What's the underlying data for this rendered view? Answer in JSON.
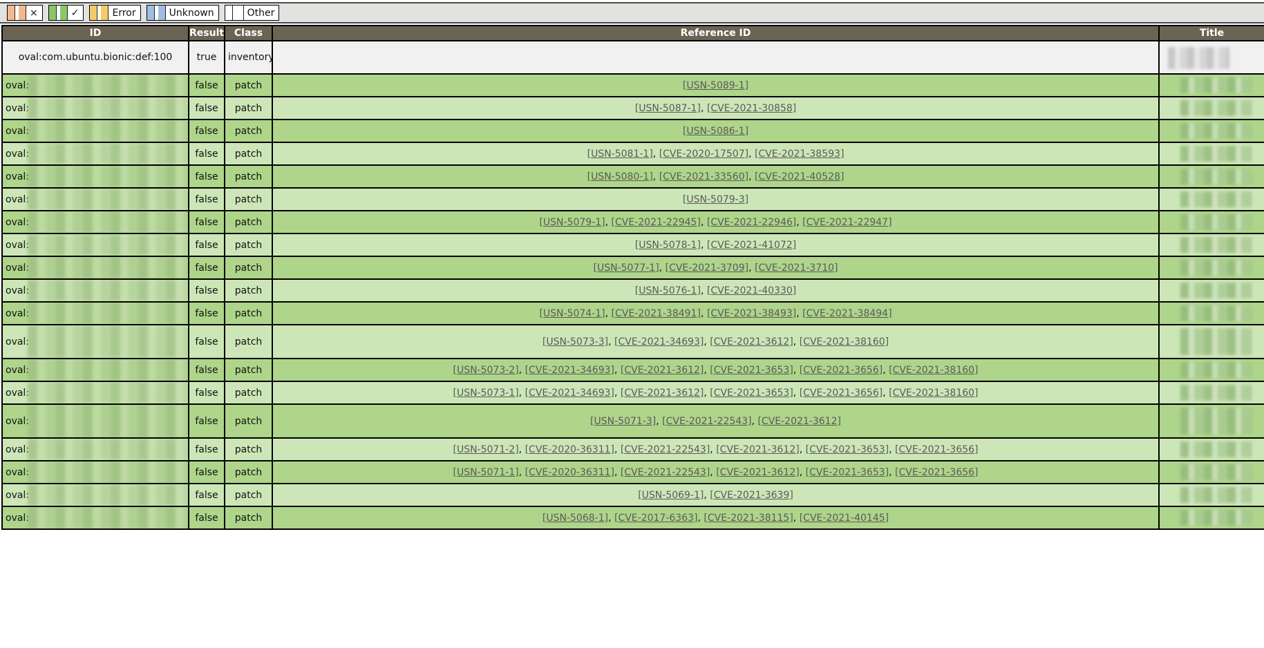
{
  "legend": [
    {
      "label": "×",
      "color": "#f4b88e"
    },
    {
      "label": "✓",
      "color": "#8cc66b"
    },
    {
      "label": "Error",
      "color": "#f6c96b"
    },
    {
      "label": "Unknown",
      "color": "#9fbde0"
    },
    {
      "label": "Other",
      "color": "#ffffff"
    }
  ],
  "columns": [
    "ID",
    "Result",
    "Class",
    "Reference ID",
    "Title"
  ],
  "colors": {
    "header_bg": "#6b6453",
    "row_alt_a": "#aed58a",
    "row_alt_b": "#cde6b7"
  },
  "rows": [
    {
      "id": "oval:com.ubuntu.bionic:def:100",
      "result": "true",
      "class": "inventory",
      "refs": [],
      "first": true
    },
    {
      "id": "oval:",
      "result": "false",
      "class": "patch",
      "refs": [
        "USN-5089-1"
      ]
    },
    {
      "id": "oval:",
      "result": "false",
      "class": "patch",
      "refs": [
        "USN-5087-1",
        "CVE-2021-30858"
      ]
    },
    {
      "id": "oval:",
      "result": "false",
      "class": "patch",
      "refs": [
        "USN-5086-1"
      ]
    },
    {
      "id": "oval:",
      "result": "false",
      "class": "patch",
      "refs": [
        "USN-5081-1",
        "CVE-2020-17507",
        "CVE-2021-38593"
      ]
    },
    {
      "id": "oval:",
      "result": "false",
      "class": "patch",
      "refs": [
        "USN-5080-1",
        "CVE-2021-33560",
        "CVE-2021-40528"
      ]
    },
    {
      "id": "oval:",
      "result": "false",
      "class": "patch",
      "refs": [
        "USN-5079-3"
      ]
    },
    {
      "id": "oval:",
      "result": "false",
      "class": "patch",
      "refs": [
        "USN-5079-1",
        "CVE-2021-22945",
        "CVE-2021-22946",
        "CVE-2021-22947"
      ]
    },
    {
      "id": "oval:",
      "result": "false",
      "class": "patch",
      "refs": [
        "USN-5078-1",
        "CVE-2021-41072"
      ]
    },
    {
      "id": "oval:",
      "result": "false",
      "class": "patch",
      "refs": [
        "USN-5077-1",
        "CVE-2021-3709",
        "CVE-2021-3710"
      ]
    },
    {
      "id": "oval:",
      "result": "false",
      "class": "patch",
      "refs": [
        "USN-5076-1",
        "CVE-2021-40330"
      ]
    },
    {
      "id": "oval:",
      "result": "false",
      "class": "patch",
      "refs": [
        "USN-5074-1",
        "CVE-2021-38491",
        "CVE-2021-38493",
        "CVE-2021-38494"
      ]
    },
    {
      "id": "oval:",
      "result": "false",
      "class": "patch",
      "refs": [
        "USN-5073-3",
        "CVE-2021-34693",
        "CVE-2021-3612",
        "CVE-2021-38160"
      ],
      "tall": true
    },
    {
      "id": "oval:",
      "result": "false",
      "class": "patch",
      "refs": [
        "USN-5073-2",
        "CVE-2021-34693",
        "CVE-2021-3612",
        "CVE-2021-3653",
        "CVE-2021-3656",
        "CVE-2021-38160"
      ]
    },
    {
      "id": "oval:",
      "result": "false",
      "class": "patch",
      "refs": [
        "USN-5073-1",
        "CVE-2021-34693",
        "CVE-2021-3612",
        "CVE-2021-3653",
        "CVE-2021-3656",
        "CVE-2021-38160"
      ]
    },
    {
      "id": "oval:",
      "result": "false",
      "class": "patch",
      "refs": [
        "USN-5071-3",
        "CVE-2021-22543",
        "CVE-2021-3612"
      ],
      "tall": true
    },
    {
      "id": "oval:",
      "result": "false",
      "class": "patch",
      "refs": [
        "USN-5071-2",
        "CVE-2020-36311",
        "CVE-2021-22543",
        "CVE-2021-3612",
        "CVE-2021-3653",
        "CVE-2021-3656"
      ]
    },
    {
      "id": "oval:",
      "result": "false",
      "class": "patch",
      "refs": [
        "USN-5071-1",
        "CVE-2020-36311",
        "CVE-2021-22543",
        "CVE-2021-3612",
        "CVE-2021-3653",
        "CVE-2021-3656"
      ]
    },
    {
      "id": "oval:",
      "result": "false",
      "class": "patch",
      "refs": [
        "USN-5069-1",
        "CVE-2021-3639"
      ]
    },
    {
      "id": "oval:",
      "result": "false",
      "class": "patch",
      "refs": [
        "USN-5068-1",
        "CVE-2017-6363",
        "CVE-2021-38115",
        "CVE-2021-40145"
      ]
    }
  ]
}
